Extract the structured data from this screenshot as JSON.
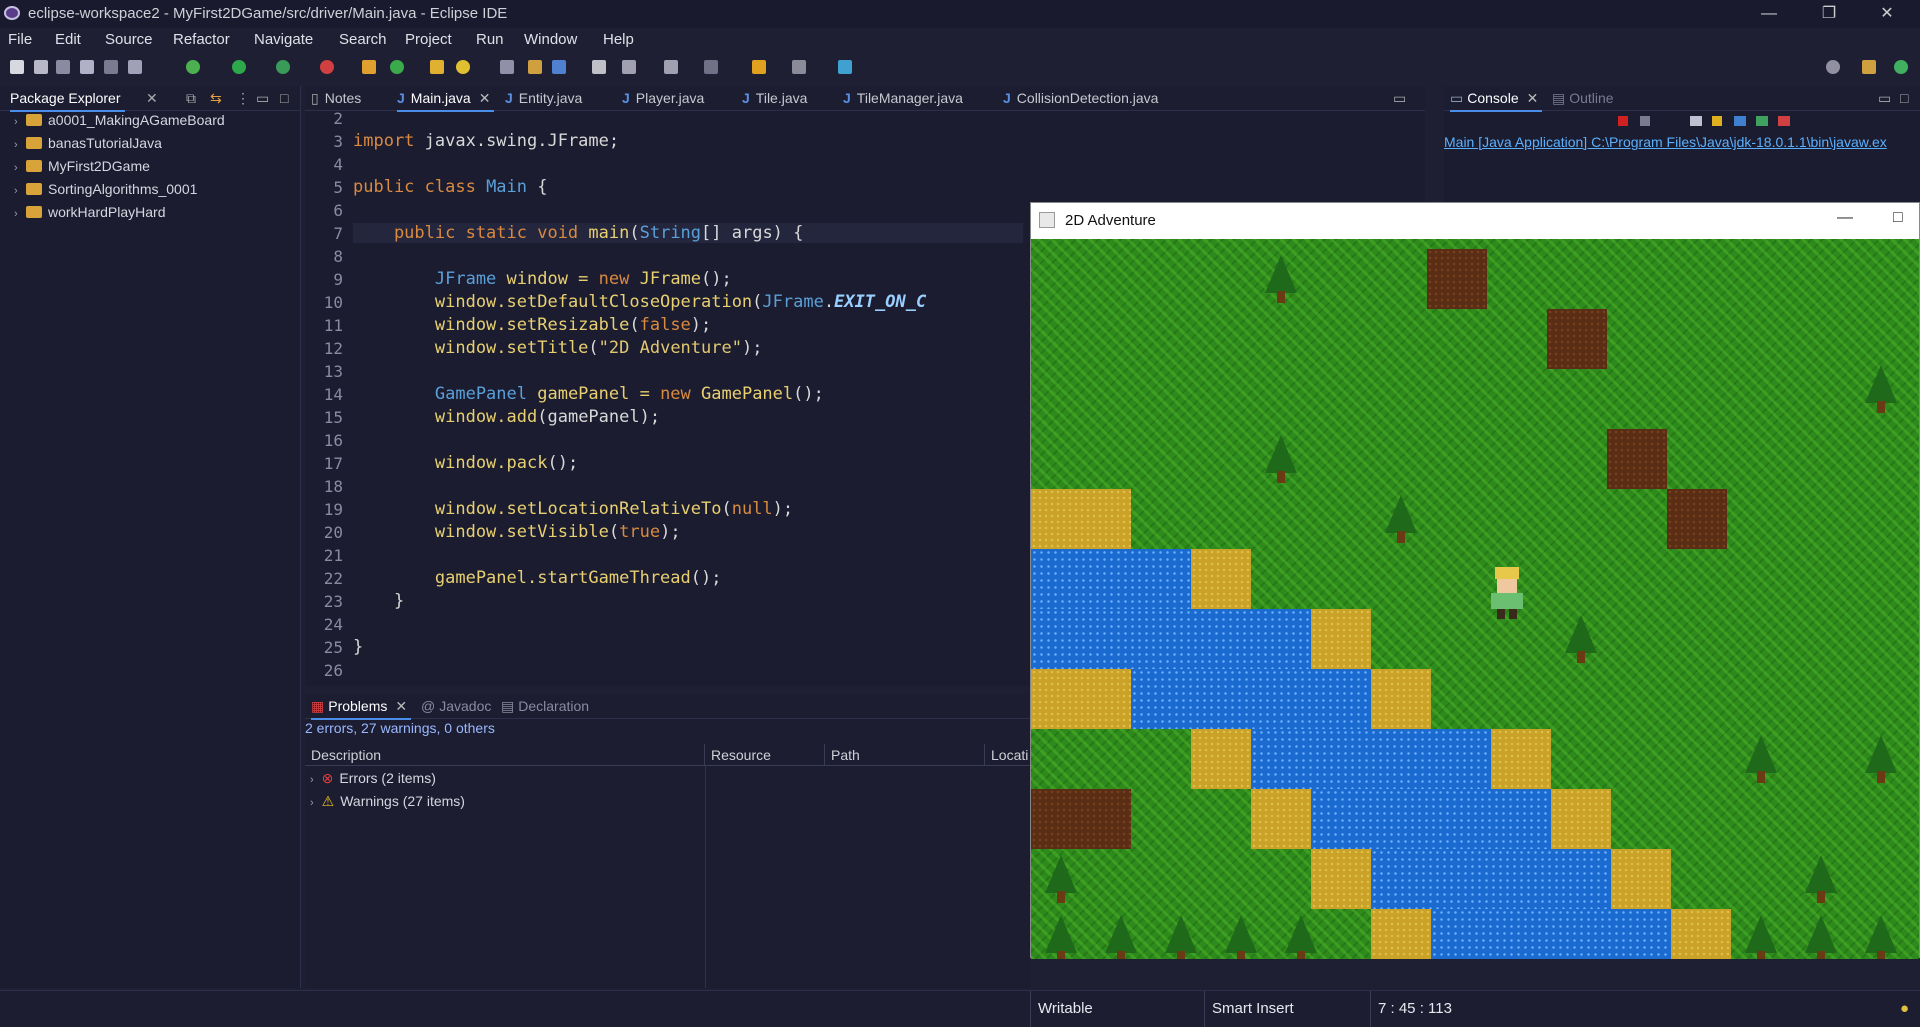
{
  "window": {
    "title": "eclipse-workspace2 - MyFirst2DGame/src/driver/Main.java - Eclipse IDE",
    "minimize": "—",
    "maximize": "❐",
    "close": "✕"
  },
  "menu": [
    "File",
    "Edit",
    "Source",
    "Refactor",
    "Navigate",
    "Search",
    "Project",
    "Run",
    "Window",
    "Help"
  ],
  "package_explorer": {
    "title": "Package Explorer",
    "items": [
      "a0001_MakingAGameBoard",
      "banasTutorialJava",
      "MyFirst2DGame",
      "SortingAlgorithms_0001",
      "workHardPlayHard"
    ]
  },
  "editor": {
    "tabs": [
      "Notes",
      "Main.java",
      "Entity.java",
      "Player.java",
      "Tile.java",
      "TileManager.java",
      "CollisionDetection.java"
    ],
    "active_tab": "Main.java",
    "line_numbers": [
      "2",
      "3",
      "4",
      "5",
      "6",
      "7",
      "8",
      "9",
      "10",
      "11",
      "12",
      "13",
      "14",
      "15",
      "16",
      "17",
      "18",
      "19",
      "20",
      "21",
      "22",
      "23",
      "24",
      "25",
      "26"
    ],
    "lines": {
      "l3a": "import",
      "l3b": " javax.swing.JFrame;",
      "l5a": "public class",
      "l5b": " Main",
      "l5c": " {",
      "l7a": "    public static void",
      "l7b": " main",
      "l7c": "(",
      "l7d": "String",
      "l7e": "[] args) {",
      "l9a": "        JFrame",
      "l9b": " window = ",
      "l9c": "new",
      "l9d": " JFrame",
      "l9e": "();",
      "l10a": "        window.",
      "l10b": "setDefaultCloseOperation",
      "l10c": "(",
      "l10d": "JFrame",
      "l10e": ".",
      "l10f": "EXIT_ON_C",
      "l11a": "        window.",
      "l11b": "setResizable",
      "l11c": "(",
      "l11d": "false",
      "l11e": ");",
      "l12a": "        window.",
      "l12b": "setTitle",
      "l12c": "(",
      "l12d": "\"2D Adventure\"",
      "l12e": ");",
      "l14a": "        GamePanel",
      "l14b": " gamePanel = ",
      "l14c": "new",
      "l14d": " GamePanel",
      "l14e": "();",
      "l15a": "        window.",
      "l15b": "add",
      "l15c": "(gamePanel);",
      "l17a": "        window.",
      "l17b": "pack",
      "l17c": "();",
      "l19a": "        window.",
      "l19b": "setLocationRelativeTo",
      "l19c": "(",
      "l19d": "null",
      "l19e": ");",
      "l20a": "        window.",
      "l20b": "setVisible",
      "l20c": "(",
      "l20d": "true",
      "l20e": ");",
      "l22a": "        gamePanel.",
      "l22b": "startGameThread",
      "l22c": "();",
      "l23": "    }",
      "l25": "}"
    }
  },
  "problems": {
    "tabs": [
      "Problems",
      "Javadoc",
      "Declaration"
    ],
    "summary": "2 errors, 27 warnings, 0 others",
    "columns": [
      "Description",
      "Resource",
      "Path",
      "Locati"
    ],
    "rows": [
      "Errors (2 items)",
      "Warnings (27 items)"
    ]
  },
  "console": {
    "tabs": [
      "Console",
      "Outline"
    ],
    "launch": "Main [Java Application] C:\\Program Files\\Java\\jdk-18.0.1.1\\bin\\javaw.ex"
  },
  "game": {
    "title": "2D Adventure"
  },
  "status": {
    "writable": "Writable",
    "insert": "Smart Insert",
    "position": "7 : 45 : 113"
  },
  "colors": {
    "accent": "#4a8ee8",
    "error": "#e04040",
    "warning": "#f0c020"
  }
}
